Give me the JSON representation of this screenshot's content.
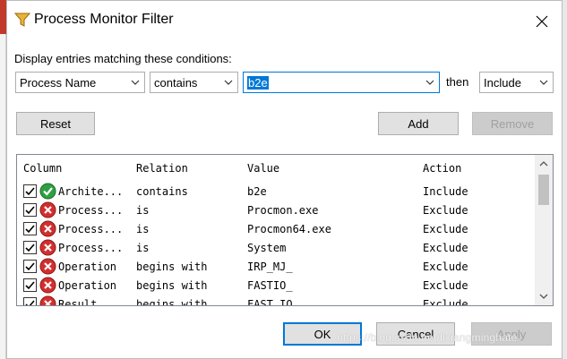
{
  "window": {
    "title": "Process Monitor Filter"
  },
  "conditions": {
    "label": "Display entries matching these conditions:",
    "column_value": "Process Name",
    "relation_value": "contains",
    "value_text": "b2e",
    "then_label": "then",
    "action_value": "Include"
  },
  "buttons": {
    "reset": "Reset",
    "add": "Add",
    "remove": "Remove",
    "ok": "OK",
    "cancel": "Cancel",
    "apply": "Apply"
  },
  "table": {
    "headers": {
      "column": "Column",
      "relation": "Relation",
      "value": "Value",
      "action": "Action"
    },
    "rows": [
      {
        "checked": true,
        "status": "include",
        "column": "Archite...",
        "relation": "contains",
        "value": "b2e",
        "action": "Include"
      },
      {
        "checked": true,
        "status": "exclude",
        "column": "Process...",
        "relation": "is",
        "value": "Procmon.exe",
        "action": "Exclude"
      },
      {
        "checked": true,
        "status": "exclude",
        "column": "Process...",
        "relation": "is",
        "value": "Procmon64.exe",
        "action": "Exclude"
      },
      {
        "checked": true,
        "status": "exclude",
        "column": "Process...",
        "relation": "is",
        "value": "System",
        "action": "Exclude"
      },
      {
        "checked": true,
        "status": "exclude",
        "column": "Operation",
        "relation": "begins with",
        "value": "IRP_MJ_",
        "action": "Exclude"
      },
      {
        "checked": true,
        "status": "exclude",
        "column": "Operation",
        "relation": "begins with",
        "value": "FASTIO_",
        "action": "Exclude"
      },
      {
        "checked": true,
        "status": "exclude",
        "column": "Result",
        "relation": "begins with",
        "value": "FAST IO",
        "action": "Exclude"
      }
    ]
  },
  "watermark": "https://blog.csdn.net/lixiangminghate",
  "colors": {
    "accent": "#0078d7",
    "include_green": "#2ea043",
    "exclude_red": "#d32f2f"
  },
  "icons": {
    "title": "filter-funnel-icon",
    "include": "green-check-icon",
    "exclude": "red-x-icon"
  }
}
